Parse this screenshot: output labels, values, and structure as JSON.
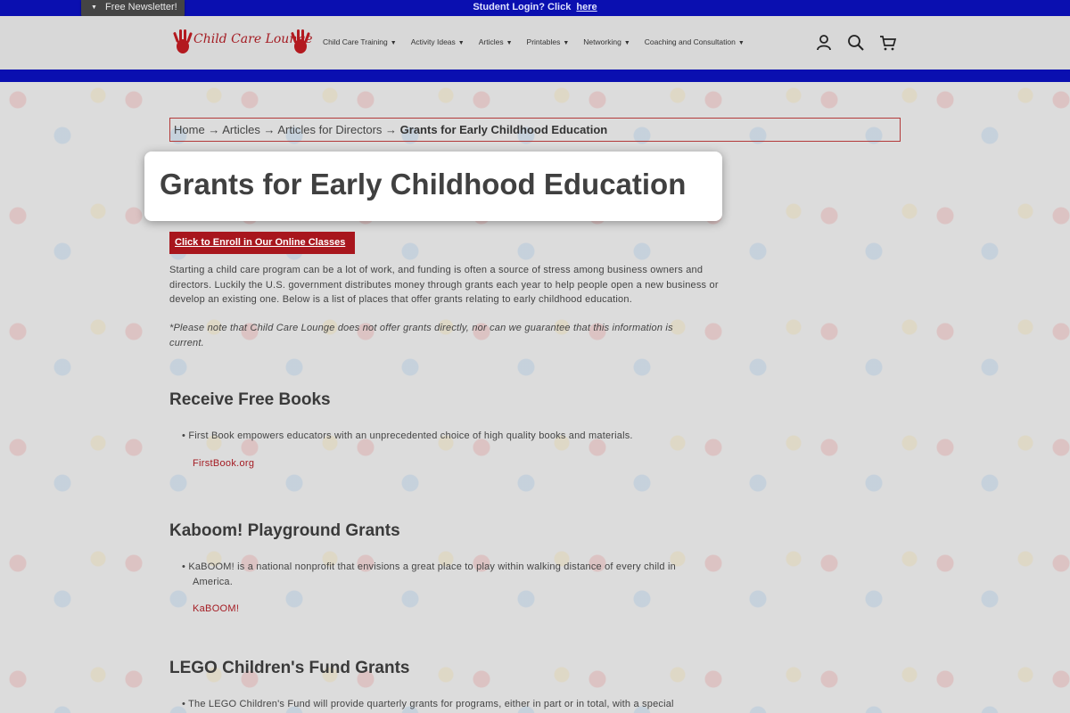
{
  "topbar": {
    "text": "Student Login? Click",
    "link": "here"
  },
  "newsletter": {
    "label": "Free Newsletter!"
  },
  "logo": {
    "text": "Child Care Lounge"
  },
  "nav": [
    {
      "label": "Child Care Training"
    },
    {
      "label": "Activity Ideas"
    },
    {
      "label": "Articles"
    },
    {
      "label": "Printables"
    },
    {
      "label": "Networking"
    },
    {
      "label": "Coaching and Consultation"
    }
  ],
  "breadcrumb": {
    "home": "Home",
    "articles": "Articles",
    "directors": "Articles for Directors",
    "current": "Grants for Early Childhood Education",
    "sep": "→"
  },
  "page": {
    "title": "Grants for Early Childhood Education",
    "enroll": "Click to Enroll in Our Online Classes",
    "intro": "Starting a child care program can be a lot of work, and funding is often a source of stress among business owners and directors. Luckily the U.S. government distributes money through grants each year to help people open a new business or develop an existing one. Below is a list of places that offer grants relating to early childhood education.",
    "note": "*Please note that Child Care Lounge does not offer grants directly, nor can we guarantee that this information is current."
  },
  "sections": [
    {
      "heading": "Receive Free Books",
      "bullet": "First Book empowers educators with an unprecedented choice of high quality books and materials.",
      "link": "FirstBook.org"
    },
    {
      "heading": "Kaboom! Playground Grants",
      "bullet": "KaBOOM! is a national nonprofit that envisions a great place to play within walking distance of every child in America.",
      "link": "KaBOOM!"
    },
    {
      "heading": "LEGO Children's Fund Grants",
      "bullet": "The LEGO Children's Fund will provide quarterly grants for programs, either in part or in total, with a special"
    }
  ],
  "colors": {
    "brand_blue": "#0a0fb0",
    "brand_red": "#a8161d"
  }
}
